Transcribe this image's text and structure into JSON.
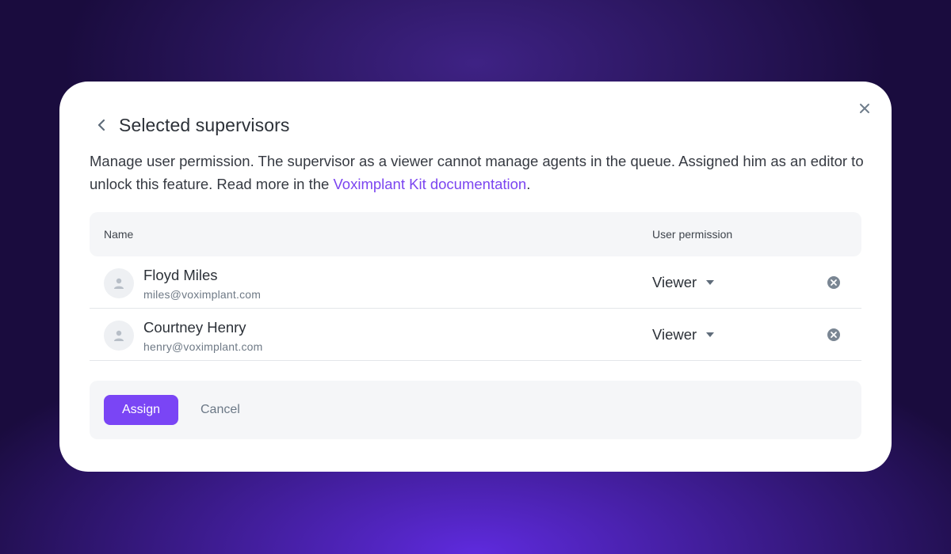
{
  "modal": {
    "title": "Selected supervisors",
    "description_prefix": "Manage user permission. The supervisor as a viewer cannot manage agents in the queue. Assigned him as an editor to unlock this feature. Read more in the ",
    "description_link": "Voximplant Kit documentation",
    "description_suffix": ".",
    "icons": {
      "back": "chevron-left-icon",
      "close": "close-icon"
    }
  },
  "table": {
    "columns": {
      "name": "Name",
      "permission": "User permission"
    },
    "rows": [
      {
        "name": "Floyd Miles",
        "email": "miles@voximplant.com",
        "permission": "Viewer"
      },
      {
        "name": "Courtney Henry",
        "email": "henry@voximplant.com",
        "permission": "Viewer"
      }
    ]
  },
  "footer": {
    "assign_label": "Assign",
    "cancel_label": "Cancel"
  },
  "colors": {
    "accent": "#7a45f5",
    "link": "#7b45f0",
    "background": "#1a0c3e"
  }
}
